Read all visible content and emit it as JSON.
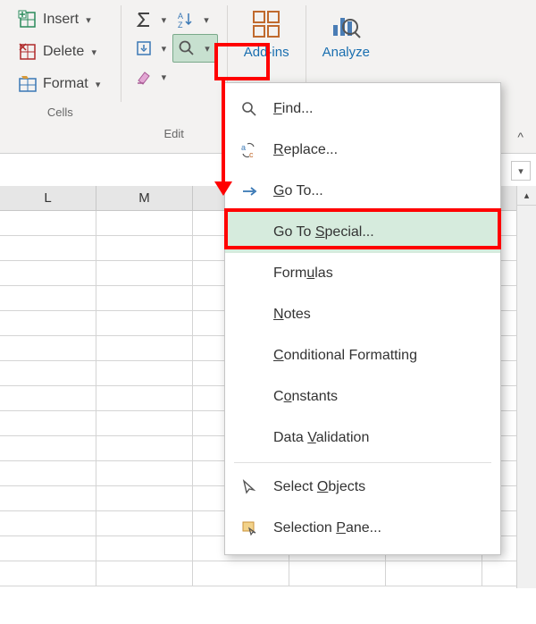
{
  "ribbon": {
    "cells": {
      "insert_label": "Insert",
      "delete_label": "Delete",
      "format_label": "Format",
      "group_label": "Cells"
    },
    "editing": {
      "group_label": "Edit",
      "sum_name": "autosum-icon",
      "fill_name": "fill-down-icon",
      "clear_name": "clear-icon",
      "sort_name": "sort-filter-icon",
      "find_name": "find-select-icon"
    },
    "addins": {
      "label": "Add-ins"
    },
    "analyze": {
      "label": "Analyze"
    }
  },
  "columns": [
    "L",
    "M"
  ],
  "menu": {
    "find": "Find...",
    "replace": "Replace...",
    "goto": "Go To...",
    "gotospecial": "Go To Special...",
    "formulas": "Formulas",
    "notes": "Notes",
    "condfmt": "Conditional Formatting",
    "constants": "Constants",
    "datavalid": "Data Validation",
    "selobjects": "Select Objects",
    "selpane": "Selection Pane..."
  }
}
